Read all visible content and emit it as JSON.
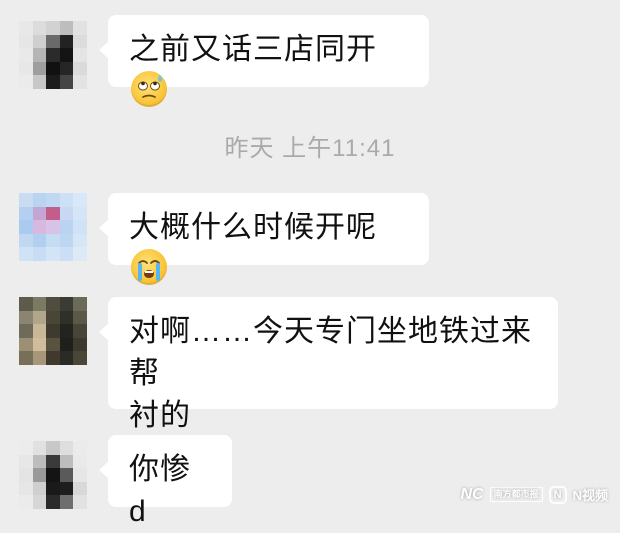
{
  "messages": [
    {
      "text": "之前又话三店同开",
      "emoji": "sweat-roll-eyes-emoji"
    },
    {
      "text": "大概什么时候开呢",
      "emoji": "crying-emoji"
    },
    {
      "line1": "对啊……今天专门坐地铁过来帮",
      "line2": "衬的"
    },
    {
      "text": "你惨 d"
    }
  ],
  "timestamp": "昨天 上午11:41",
  "watermark": {
    "brand": "NC",
    "tag": "南方都市报",
    "app": "N视频"
  }
}
